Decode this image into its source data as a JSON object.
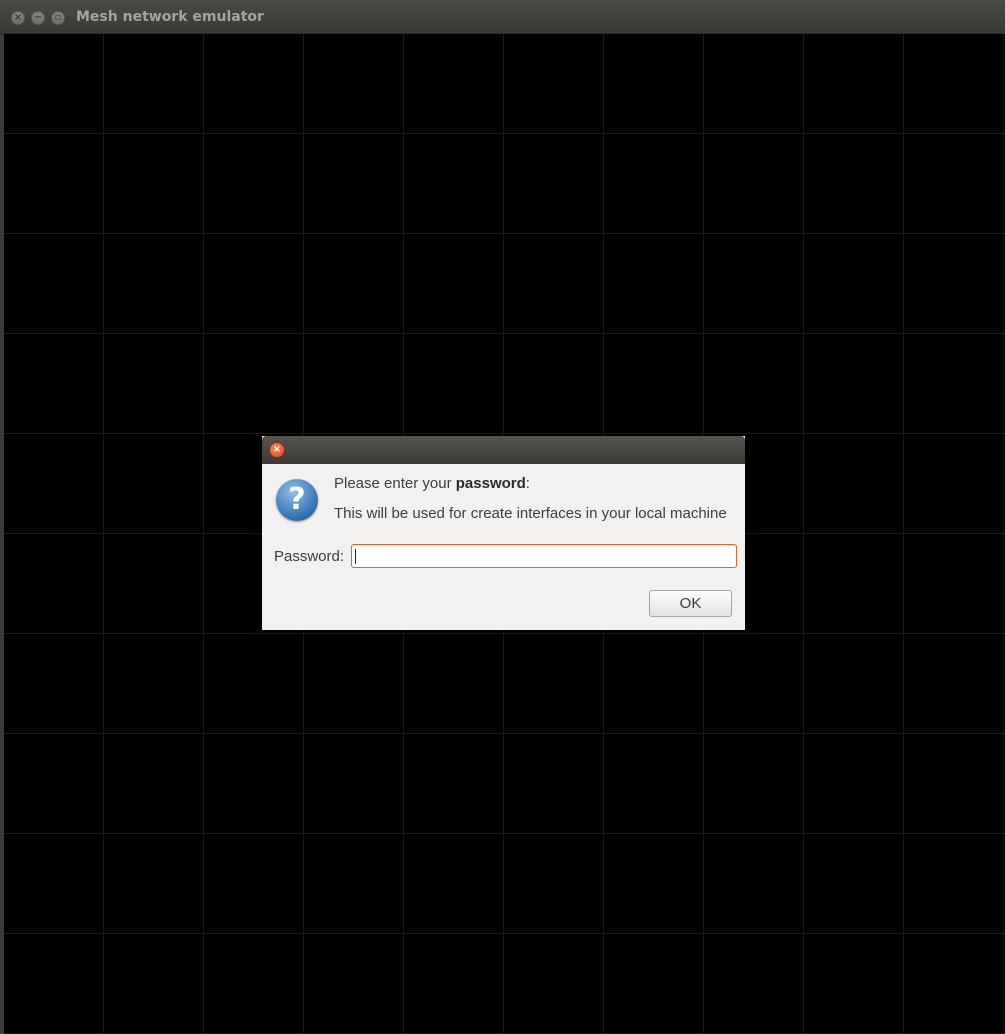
{
  "window": {
    "title": "Mesh network emulator",
    "close_glyph": "×",
    "minimize_glyph": "−",
    "maximize_glyph": "▫"
  },
  "dialog": {
    "close_glyph": "×",
    "icon": "question-icon",
    "icon_glyph": "?",
    "message_prefix": "Please enter your ",
    "message_bold": "password",
    "message_suffix": ":",
    "submessage": "This will be used for create interfaces in your local machine",
    "password_label": "Password:",
    "password_value": "",
    "ok_label": "OK"
  },
  "colors": {
    "canvas_bg": "#000000",
    "grid_line": "#1a1a1a",
    "dialog_bg": "#f2f1f0",
    "focus_border": "#e0642c",
    "close_button": "#df4a16"
  }
}
